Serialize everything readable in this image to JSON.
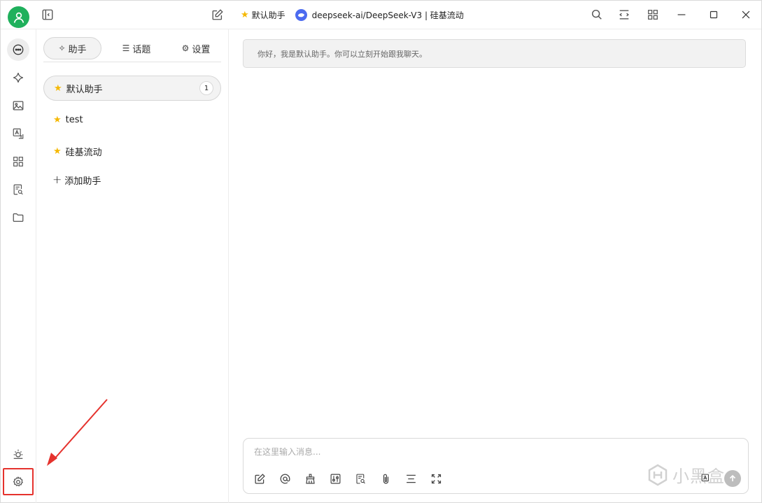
{
  "header": {
    "assistant_name": "默认助手",
    "model_label": "deepseek-ai/DeepSeek-V3 | 硅基流动"
  },
  "sidebar_rail": {
    "items": [
      "chat-icon",
      "sparkle-icon",
      "image-icon",
      "translate-icon",
      "apps-icon",
      "knowledge-icon",
      "folder-icon"
    ],
    "bottom": [
      "theme-sun-icon",
      "gear-icon"
    ]
  },
  "panel": {
    "tabs": [
      {
        "label": "助手",
        "icon": "sparkle-icon"
      },
      {
        "label": "话题",
        "icon": "list-icon"
      },
      {
        "label": "设置",
        "icon": "gear-icon"
      }
    ],
    "assistants": [
      {
        "name": "默认助手",
        "badge": "1"
      },
      {
        "name": "test"
      },
      {
        "name": "硅基流动"
      }
    ],
    "add_label": "添加助手"
  },
  "chat": {
    "greeting": "你好，我是默认助手。你可以立刻开始跟我聊天。",
    "input_placeholder": "在这里输入消息..."
  },
  "watermark": {
    "text": "小黑盒"
  },
  "colors": {
    "avatar": "#1fb05c",
    "star": "#f5b800",
    "highlight": "#e5322d",
    "model_logo": "#4c6bf0"
  }
}
